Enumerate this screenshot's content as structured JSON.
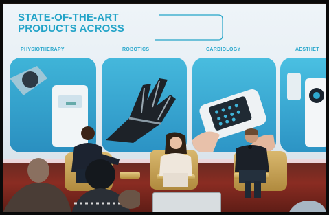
{
  "screen": {
    "headline_line1": "STATE-OF-THE-ART",
    "headline_line2": "PRODUCTS ACROSS",
    "categories": [
      "PHYSIOTHERAPY",
      "ROBOTICS",
      "CARDIOLOGY",
      "AESTHET"
    ]
  },
  "colors": {
    "accent": "#23a4c8",
    "stage_carpet": "#8a2c22",
    "chair_gold": "#c9a452"
  }
}
